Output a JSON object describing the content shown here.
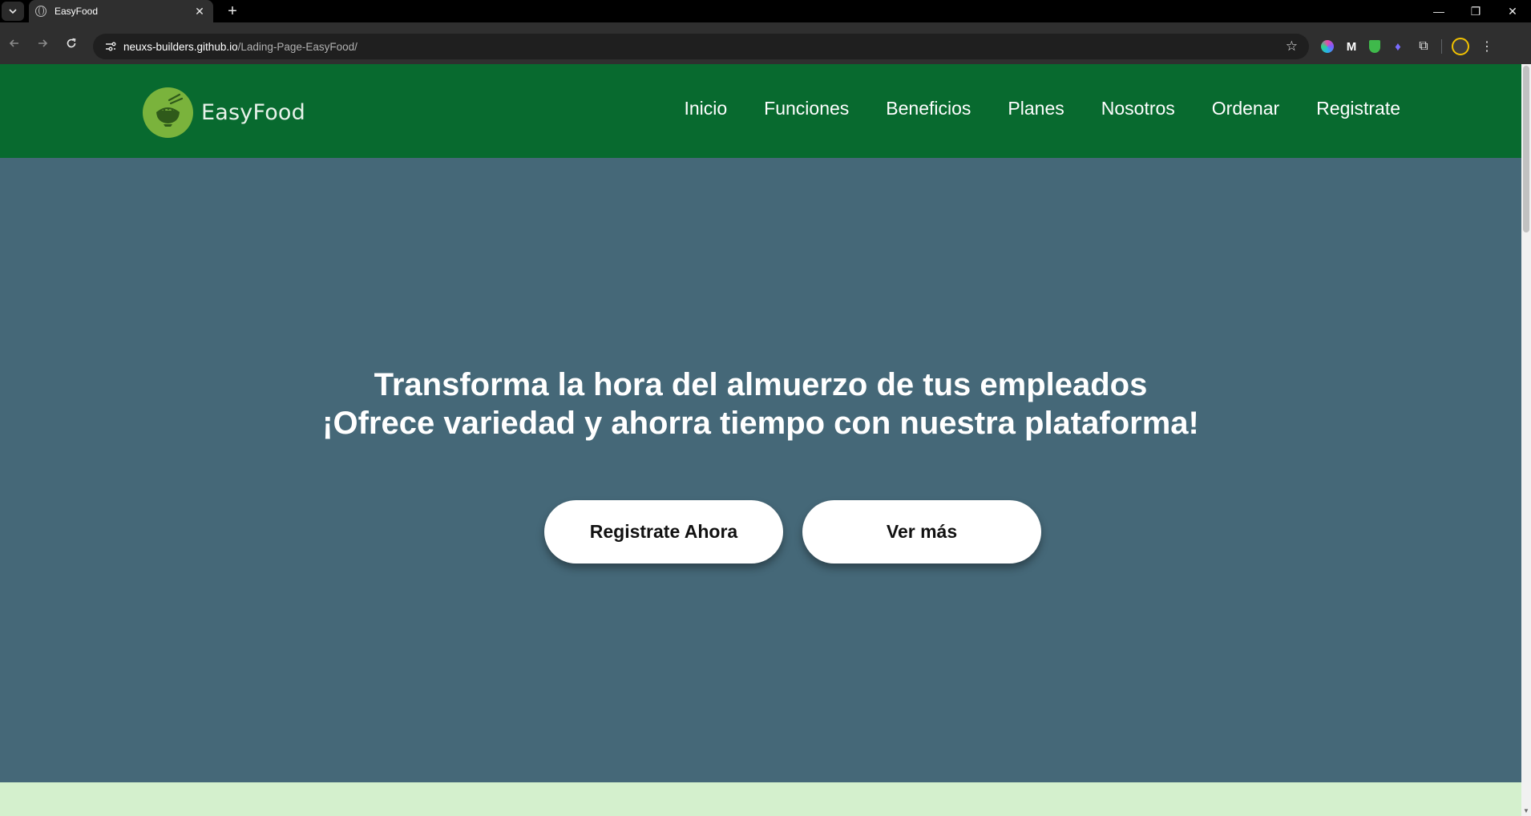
{
  "browser": {
    "tab_title": "EasyFood",
    "tab_close_glyph": "✕",
    "new_tab_glyph": "+",
    "url_host": "neuxs-builders.github.io",
    "url_path": "/Lading-Page-EasyFood/",
    "window_controls": [
      "—",
      "❐",
      "✕"
    ]
  },
  "header": {
    "brand": "EasyFood",
    "brand_color": "#7ab33c",
    "nav": [
      "Inicio",
      "Funciones",
      "Beneficios",
      "Planes",
      "Nosotros",
      "Ordenar",
      "Registrate"
    ],
    "background": "#086a2f"
  },
  "hero": {
    "title_line1": "Transforma la hora del almuerzo de tus empleados",
    "title_line2": "¡Ofrece variedad y ahorra tiempo con nuestra plataforma!",
    "primary_button": "Registrate Ahora",
    "secondary_button": "Ver más",
    "background": "#456878"
  },
  "next_section": {
    "background": "#d4f0cd"
  }
}
